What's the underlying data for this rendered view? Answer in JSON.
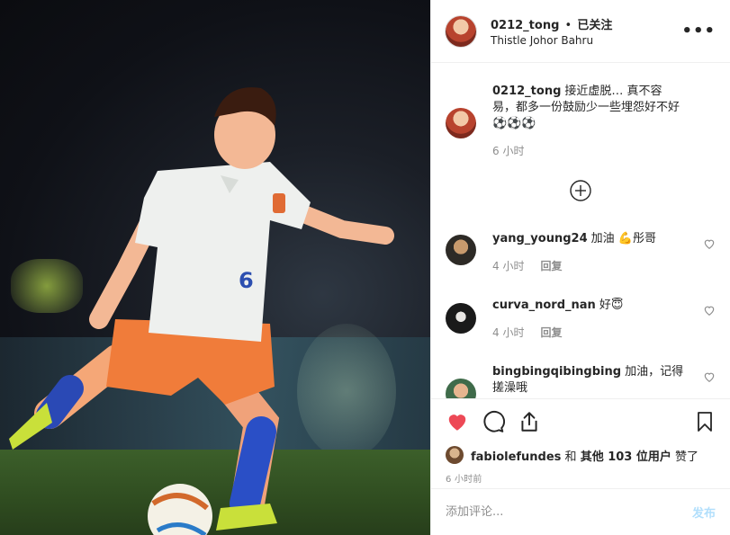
{
  "post": {
    "username": "0212_tong",
    "separator": "•",
    "follow_status": "已关注",
    "location": "Thistle Johor Bahru",
    "more_icon": "more-horizontal-icon"
  },
  "caption": {
    "username": "0212_tong",
    "text": "接近虚脱… 真不容易，都多一份鼓励少一些埋怨好不好⚽️⚽️⚽️",
    "time": "6 小时"
  },
  "comments": [
    {
      "username": "yang_young24",
      "text": "加油 💪彤哥",
      "time": "4 小时",
      "reply": "回复"
    },
    {
      "username": "curva_nord_nan",
      "text": "好😇",
      "time": "4 小时",
      "reply": "回复"
    },
    {
      "username": "bingbingqibingbing",
      "text": "加油，记得搓澡哦",
      "time": "",
      "reply": ""
    }
  ],
  "likes": {
    "user": "fabiolefundes",
    "connector": " 和 ",
    "others": "其他 103 位用户",
    "suffix": " 赞了"
  },
  "timestamp": "6 小时前",
  "add_comment": {
    "placeholder": "添加评论...",
    "post_label": "发布"
  },
  "colors": {
    "like_red": "#ed4956",
    "post_blue_disabled": "#b2dffc",
    "muted_gray": "#8e8e8e"
  }
}
